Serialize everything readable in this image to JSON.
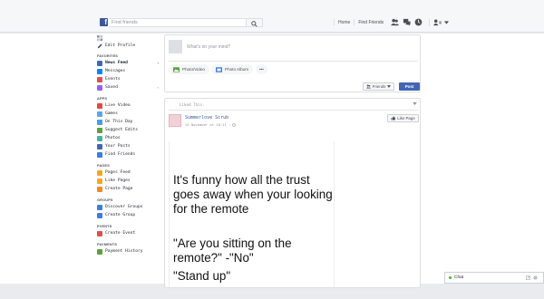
{
  "header": {
    "logo_letter": "f",
    "search_placeholder": "Find friends",
    "nav_links": [
      "Home",
      "Find Friends"
    ],
    "icons": [
      "friend-requests-icon",
      "messages-icon",
      "notifications-icon",
      "account-icon",
      "dropdown-caret-icon"
    ]
  },
  "sidebar": {
    "edit_profile": "Edit Profile",
    "sections": [
      {
        "title": "FAVORITES",
        "items": [
          {
            "label": "News Feed",
            "icon": "news-feed-icon",
            "color": "#4267b2",
            "chevron": true,
            "active": true
          },
          {
            "label": "Messages",
            "icon": "messages-icon",
            "color": "#0084ff"
          },
          {
            "label": "Events",
            "icon": "events-icon",
            "color": "#e24d4d"
          },
          {
            "label": "Saved",
            "icon": "saved-icon",
            "color": "#9360f7",
            "chevron": true
          }
        ]
      },
      {
        "title": "APPS",
        "items": [
          {
            "label": "Live Video",
            "icon": "live-video-icon",
            "color": "#e9463d"
          },
          {
            "label": "Games",
            "icon": "games-icon",
            "color": "#5aa7e6"
          },
          {
            "label": "On This Day",
            "icon": "on-this-day-icon",
            "color": "#4b9ce8"
          },
          {
            "label": "Suggest Edits",
            "icon": "suggest-edits-icon",
            "color": "#58a33a"
          },
          {
            "label": "Photos",
            "icon": "photos-icon",
            "color": "#44b3a4"
          },
          {
            "label": "Your Posts",
            "icon": "your-posts-icon",
            "color": "#4267b2"
          },
          {
            "label": "Find Friends",
            "icon": "find-friends-icon",
            "color": "#3b7de0"
          }
        ]
      },
      {
        "title": "PAGES",
        "items": [
          {
            "label": "Pages Feed",
            "icon": "pages-feed-icon",
            "color": "#f5a623"
          },
          {
            "label": "Like Pages",
            "icon": "like-pages-icon",
            "color": "#f5a623"
          },
          {
            "label": "Create Page",
            "icon": "create-page-icon",
            "color": "#f08a24"
          }
        ]
      },
      {
        "title": "GROUPS",
        "items": [
          {
            "label": "Discover Groups",
            "icon": "discover-groups-icon",
            "color": "#3b7de0"
          },
          {
            "label": "Create Group",
            "icon": "create-group-icon",
            "color": "#3b7de0"
          }
        ]
      },
      {
        "title": "EVENTS",
        "items": [
          {
            "label": "Create Event",
            "icon": "create-event-icon",
            "color": "#e24d4d"
          }
        ]
      },
      {
        "title": "PAYMENTS",
        "items": [
          {
            "label": "Payment History",
            "icon": "payment-history-icon",
            "color": "#58a33a"
          }
        ]
      }
    ]
  },
  "composer": {
    "placeholder": "What's on your mind?",
    "photo_video": "Photo/Video",
    "photo_album": "Photo Album",
    "more": "•••",
    "audience": "Friends",
    "post": "Post"
  },
  "post": {
    "liked_text": "Liked This.",
    "page_name": "Summerlove Scrub",
    "timestamp": "15 November at 10:11 ·",
    "like_page": "Like Page",
    "meme_lines": [
      "It's funny how all the trust goes away when your looking for the remote",
      "\"Are you sitting on the remote?\" -\"No\"",
      "\"Stand up\""
    ]
  },
  "chat": {
    "label": "Chat"
  },
  "colors": {
    "brand": "#3b5998",
    "post_button": "#4267b2",
    "link": "#365899",
    "online": "#42b72a"
  }
}
